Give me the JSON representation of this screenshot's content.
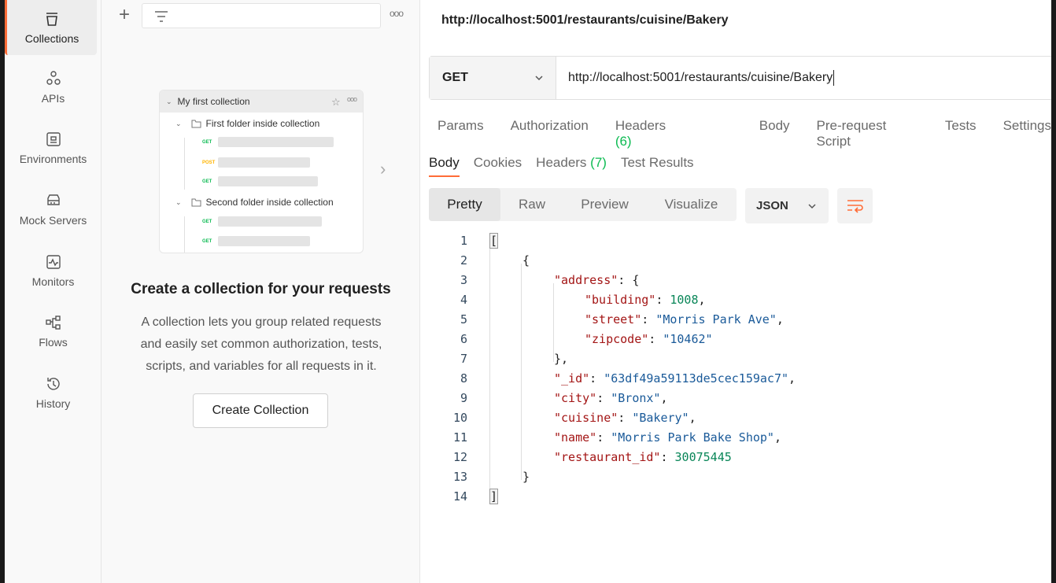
{
  "nav": {
    "items": [
      {
        "label": "Collections",
        "icon": "collections-icon",
        "active": true
      },
      {
        "label": "APIs",
        "icon": "apis-icon"
      },
      {
        "label": "Environments",
        "icon": "environments-icon"
      },
      {
        "label": "Mock Servers",
        "icon": "mock-servers-icon"
      },
      {
        "label": "Monitors",
        "icon": "monitors-icon"
      },
      {
        "label": "Flows",
        "icon": "flows-icon"
      },
      {
        "label": "History",
        "icon": "history-icon"
      }
    ]
  },
  "panel": {
    "preview": {
      "collection": "My first collection",
      "folder1": "First folder inside collection",
      "folder2": "Second folder inside collection",
      "methods": [
        "GET",
        "POST",
        "GET",
        "GET",
        "GET"
      ]
    },
    "empty_title": "Create a collection for your requests",
    "empty_desc_lines": [
      "A collection lets you group related requests",
      "and easily set common authorization, tests,",
      "scripts, and variables for all requests in it."
    ],
    "create_button": "Create Collection"
  },
  "request": {
    "title": "http://localhost:5001/restaurants/cuisine/Bakery",
    "method": "GET",
    "url": "http://localhost:5001/restaurants/cuisine/Bakery",
    "tabs": {
      "params": "Params",
      "authorization": "Authorization",
      "headers": "Headers",
      "headers_count": "(6)",
      "body": "Body",
      "pre_request": "Pre-request Script",
      "tests": "Tests",
      "settings": "Settings"
    }
  },
  "response": {
    "tabs": {
      "body": "Body",
      "cookies": "Cookies",
      "headers": "Headers",
      "headers_count": "(7)",
      "test_results": "Test Results"
    },
    "views": [
      "Pretty",
      "Raw",
      "Preview",
      "Visualize"
    ],
    "format": "JSON",
    "code": {
      "line_numbers": [
        "1",
        "2",
        "3",
        "4",
        "5",
        "6",
        "7",
        "8",
        "9",
        "10",
        "11",
        "12",
        "13",
        "14"
      ],
      "l1": "[",
      "l2": "{",
      "l3_key": "\"address\"",
      "l3_rest": ": {",
      "l4_key": "\"building\"",
      "l4_val": "1008",
      "l5_key": "\"street\"",
      "l5_val": "\"Morris Park Ave\"",
      "l6_key": "\"zipcode\"",
      "l6_val": "\"10462\"",
      "l7": "},",
      "l8_key": "\"_id\"",
      "l8_val": "\"63df49a59113de5cec159ac7\"",
      "l9_key": "\"city\"",
      "l9_val": "\"Bronx\"",
      "l10_key": "\"cuisine\"",
      "l10_val": "\"Bakery\"",
      "l11_key": "\"name\"",
      "l11_val": "\"Morris Park Bake Shop\"",
      "l12_key": "\"restaurant_id\"",
      "l12_val": "30075445",
      "l13": "}",
      "l14": "]"
    }
  },
  "colors": {
    "accent": "#ff6c37",
    "green": "#0cbb52",
    "json_key": "#a31515",
    "json_string": "#1a5a99",
    "json_number": "#098658"
  }
}
